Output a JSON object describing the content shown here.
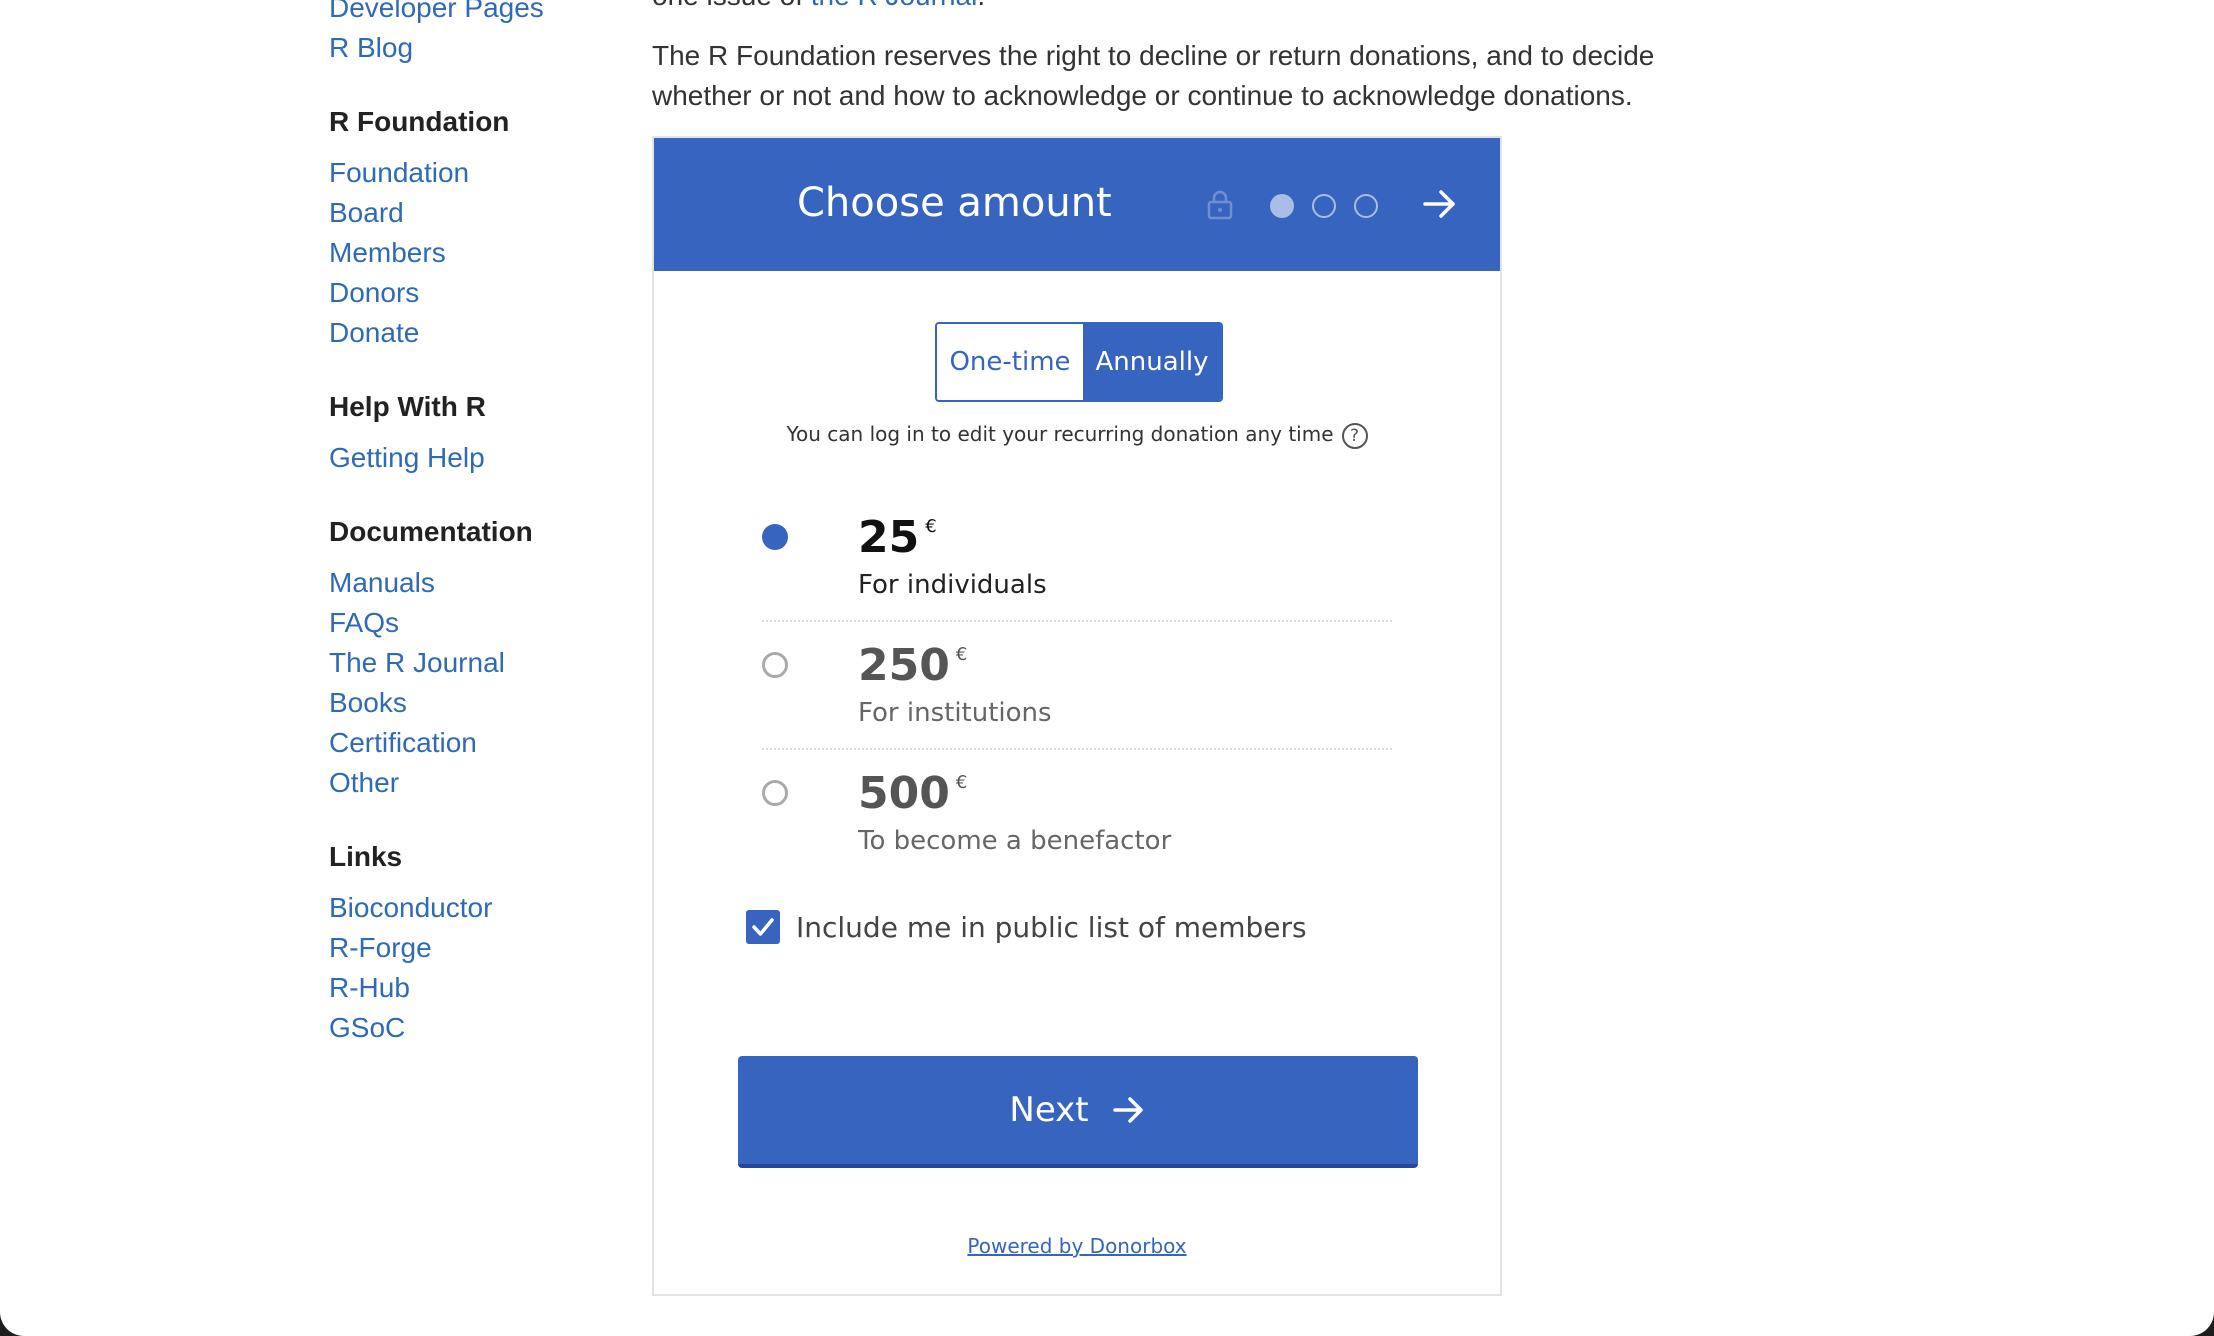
{
  "sidebar": {
    "top_links": [
      "Developer Pages",
      "R Blog"
    ],
    "sections": [
      {
        "heading": "R Foundation",
        "links": [
          "Foundation",
          "Board",
          "Members",
          "Donors",
          "Donate"
        ]
      },
      {
        "heading": "Help With R",
        "links": [
          "Getting Help"
        ]
      },
      {
        "heading": "Documentation",
        "links": [
          "Manuals",
          "FAQs",
          "The R Journal",
          "Books",
          "Certification",
          "Other"
        ]
      },
      {
        "heading": "Links",
        "links": [
          "Bioconductor",
          "R-Forge",
          "R-Hub",
          "GSoC"
        ]
      }
    ]
  },
  "main": {
    "partial_line_prefix": "one issue of ",
    "partial_line_link": "the R Journal",
    "partial_line_suffix": ".",
    "paragraph": "The R Foundation reserves the right to decline or return donations, and to decide whether or not and how to acknowledge or continue to acknowledge donations."
  },
  "widget": {
    "title": "Choose amount",
    "steps": 3,
    "current_step": 1,
    "frequency": {
      "one_time": "One-time",
      "annually": "Annually",
      "selected": "Annually"
    },
    "note": "You can log in to edit your recurring donation any time",
    "help_glyph": "?",
    "options": [
      {
        "amount": "25",
        "currency": "€",
        "desc": "For individuals",
        "selected": true
      },
      {
        "amount": "250",
        "currency": "€",
        "desc": "For institutions",
        "selected": false
      },
      {
        "amount": "500",
        "currency": "€",
        "desc": "To become a benefactor",
        "selected": false
      }
    ],
    "public_list_label": "Include me in public list of members",
    "public_list_checked": true,
    "next_label": "Next",
    "powered_by": "Powered by Donorbox",
    "accent_color": "#3764be"
  }
}
